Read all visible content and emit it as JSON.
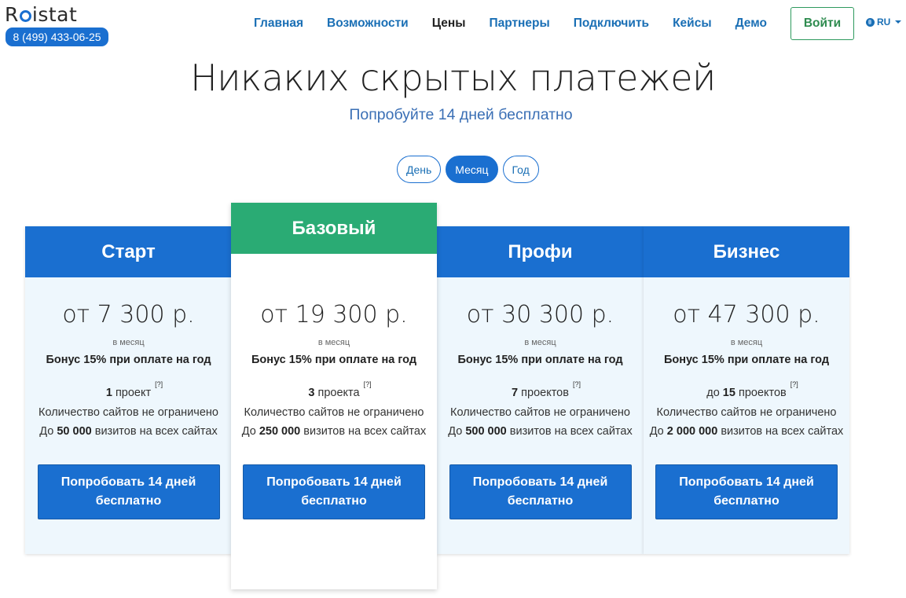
{
  "header": {
    "logo_text_1": "R",
    "logo_text_2": "istat",
    "phone": "8 (499) 433-06-25",
    "nav": [
      "Главная",
      "Возможности",
      "Цены",
      "Партнеры",
      "Подключить",
      "Кейсы",
      "Демо"
    ],
    "nav_active": "Цены",
    "login_label": "Войти",
    "lang_label": "RU"
  },
  "hero": {
    "title": "Никаких скрытых платежей",
    "subtitle": "Попробуйте 14 дней бесплатно"
  },
  "periods": {
    "day": "День",
    "month": "Месяц",
    "year": "Год",
    "active": "Месяц"
  },
  "plans": [
    {
      "name": "Старт",
      "price": "от 7 300 р.",
      "per": "в месяц",
      "bonus": "Бонус 15% при оплате на год",
      "projects_prefix": "",
      "projects_count": "1",
      "projects_label": " проект",
      "hint": "[?]",
      "sites": "Количество сайтов не ограничено",
      "visits_prefix": "До ",
      "visits_count": "50 000",
      "visits_suffix": " визитов на всех сайтах",
      "button": "Попробовать 14 дней бесплатно"
    },
    {
      "name": "Базовый",
      "price": "от 19 300 р.",
      "per": "в месяц",
      "bonus": "Бонус 15% при оплате на год",
      "projects_prefix": "",
      "projects_count": "3",
      "projects_label": " проекта",
      "hint": "[?]",
      "sites": "Количество сайтов не ограничено",
      "visits_prefix": "До ",
      "visits_count": "250 000",
      "visits_suffix": " визитов на всех сайтах",
      "button": "Попробовать 14 дней бесплатно"
    },
    {
      "name": "Профи",
      "price": "от 30 300 р.",
      "per": "в месяц",
      "bonus": "Бонус 15% при оплате на год",
      "projects_prefix": "",
      "projects_count": "7",
      "projects_label": " проектов",
      "hint": "[?]",
      "sites": "Количество сайтов не ограничено",
      "visits_prefix": "До ",
      "visits_count": "500 000",
      "visits_suffix": " визитов на всех сайтах",
      "button": "Попробовать 14 дней бесплатно"
    },
    {
      "name": "Бизнес",
      "price": "от 47 300 р.",
      "per": "в месяц",
      "bonus": "Бонус 15% при оплате на год",
      "projects_prefix": "до ",
      "projects_count": "15",
      "projects_label": " проектов",
      "hint": "[?]",
      "sites": "Количество сайтов не ограничено",
      "visits_prefix": "До ",
      "visits_count": "2 000 000",
      "visits_suffix": " визитов на всех сайтах",
      "button": "Попробовать 14 дней бесплатно"
    }
  ],
  "colors": {
    "primary_blue": "#1a6fd0",
    "featured_green": "#2aab74",
    "card_bg": "#eef7fd",
    "login_green": "#2e8b4f"
  }
}
